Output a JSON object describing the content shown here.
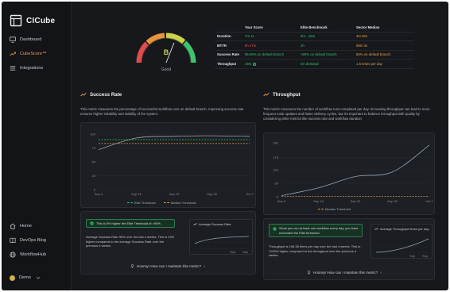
{
  "app": {
    "name": "CICube"
  },
  "sidebar": {
    "items": [
      {
        "label": "Dashboard",
        "icon": "monitor-icon"
      },
      {
        "label": "CubeScore™",
        "icon": "trend-icon",
        "active": true
      },
      {
        "label": "Integrations",
        "icon": "list-icon"
      }
    ],
    "bottom_items": [
      {
        "label": "Home",
        "icon": "home-icon"
      },
      {
        "label": "DevOps Blog",
        "icon": "book-icon"
      },
      {
        "label": "WorkflowHub",
        "icon": "globe-icon"
      }
    ],
    "user": {
      "label": "Demo"
    }
  },
  "gauge": {
    "grade": "B",
    "label": "Good",
    "level": 0.62
  },
  "metrics_table": {
    "headers": [
      "",
      "Your Score",
      "Elite Benchmark",
      "Sector Median"
    ],
    "rows": [
      {
        "name": "Duration",
        "score": "7m 1s",
        "elite": "5m - 10m",
        "median": "3m 50s",
        "score_color": "green",
        "median_color": "orange"
      },
      {
        "name": "MTTR",
        "score": "8h 27m",
        "elite": "1h",
        "median": "58m 3s",
        "score_color": "red",
        "median_color": "orange"
      },
      {
        "name": "Success Rate",
        "score": "95.69% on default branch",
        "elite": ">90% on default branch",
        "median": "83% on default branch",
        "score_color": "green",
        "median_color": "orange"
      },
      {
        "name": "Throughput",
        "score": "19m",
        "elite": "On demand",
        "median": "1.5 times per day",
        "score_color": "green",
        "median_color": "orange"
      }
    ]
  },
  "success_rate": {
    "title": "Success Rate",
    "description": "This metric measures the percentage of successful workflow runs on default branch. Improving success rate ensures higher reliability and stability of the system.",
    "legend": {
      "elite": "Elite Threshold",
      "median": "Median Threshold"
    },
    "insight": {
      "badge": "This is 6% higher the Elite Threshold of >90%.",
      "text": "Average Success Rate 96% over the last 4 weeks. This is 24% higher compared to the average Success Rate over the previous 4 weeks."
    },
    "mini_title": "Average Success Rate",
    "mini_ticks": [
      "Sep",
      "Sep"
    ],
    "hooray": "Hooray! How can I maintain this metric?"
  },
  "throughput": {
    "title": "Throughput",
    "description": "This metric measures the number of workflow runs completed per day. Increasing throughput can lead to more frequent code updates and faster delivery cycles, but it's important to balance throughput with quality by considering other metrics like success rate and workflow duration",
    "legend": {
      "median": "Median Threshold"
    },
    "insight": {
      "badge": "Since you run at least one workflow every day, you have exceeded the Elite threshold.",
      "text": "Throughput is 106.36 times per day over the last 4 weeks. This is 1033% higher compared to the throughput over the previous 4 weeks."
    },
    "mini_title": "Average Throughput times per day",
    "mini_ticks": [
      "Sep",
      "Sep"
    ],
    "hooray": "Hooray! How can I maintain this metric?"
  },
  "chart_data": [
    {
      "type": "line",
      "title": "Success Rate",
      "x": [
        "Sep 9",
        "Sep 16",
        "Sep 23",
        "Sep 30",
        "Oct 7"
      ],
      "ylim": [
        0,
        100
      ],
      "yticks": [
        "0",
        "25",
        "50",
        "75",
        "100"
      ],
      "series": [
        {
          "name": "",
          "values": [
            72,
            93,
            96,
            97,
            96
          ]
        },
        {
          "name": "Elite Threshold",
          "values": [
            90,
            90,
            90,
            90,
            90
          ]
        },
        {
          "name": "Median Threshold",
          "values": [
            83,
            83,
            83,
            83,
            83
          ]
        }
      ],
      "colors": {
        "line": "#9aa4b5",
        "elite": "#33c66f",
        "median": "#f2a043"
      }
    },
    {
      "type": "line",
      "title": "Throughput",
      "x": [
        "Sep 9",
        "Sep 16",
        "Sep 23",
        "Sep 30",
        "Oct 7"
      ],
      "ylim": [
        0,
        240
      ],
      "yticks": [
        "0",
        "60",
        "120",
        "175",
        "240"
      ],
      "series": [
        {
          "name": "",
          "values": [
            5,
            40,
            90,
            110,
            230
          ]
        },
        {
          "name": "Median Threshold",
          "values": [
            1.5,
            1.5,
            1.5,
            1.5,
            1.5
          ]
        }
      ],
      "colors": {
        "line": "#9aa4b5",
        "median": "#f2a043"
      }
    }
  ]
}
